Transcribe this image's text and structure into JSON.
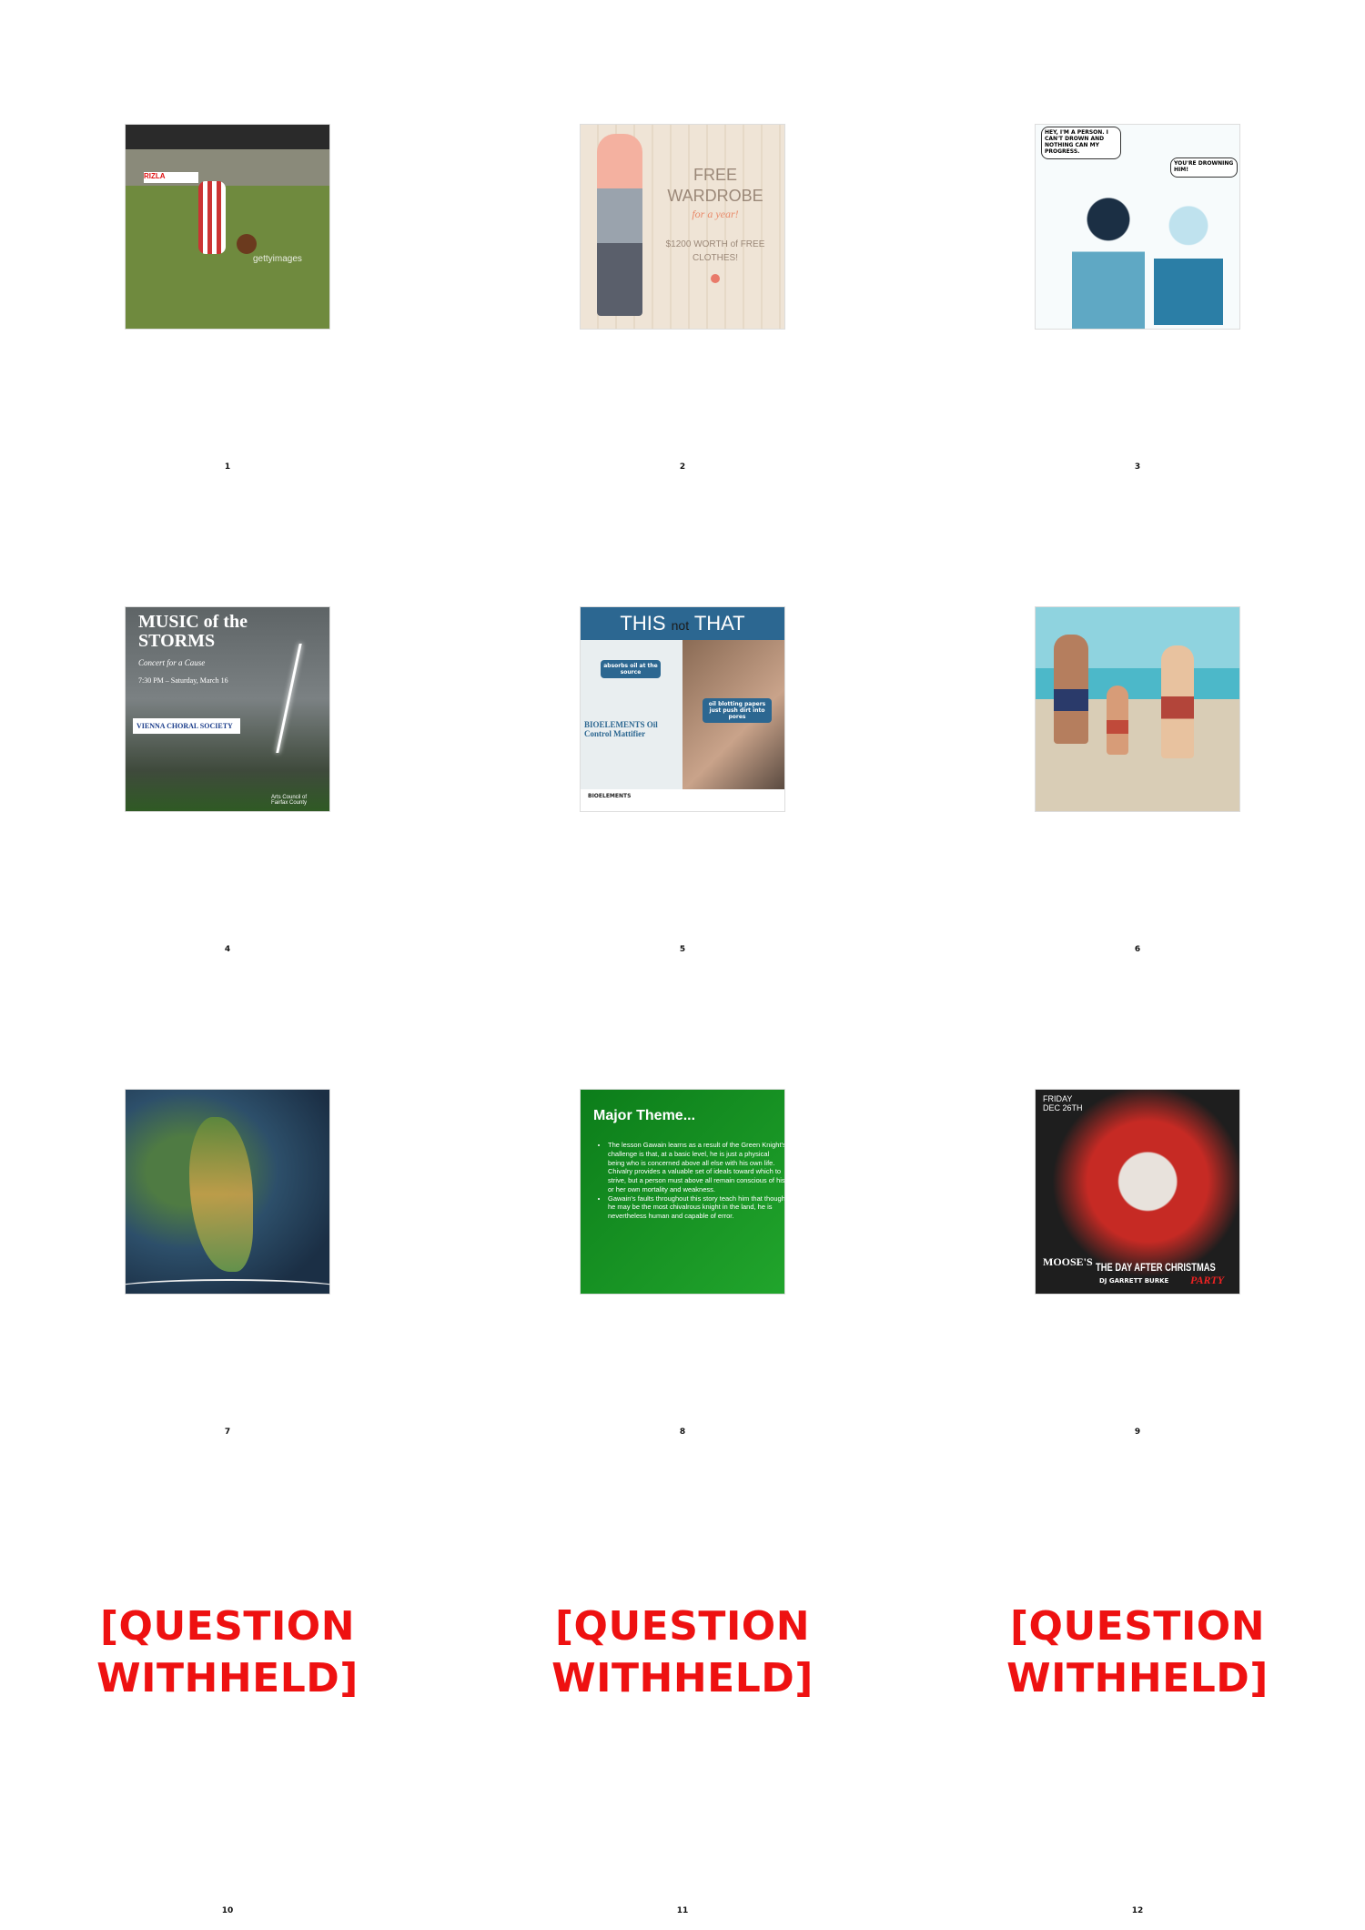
{
  "tiles": [
    {
      "number": "1",
      "watermark": "gettyimages"
    },
    {
      "number": "2",
      "headline": "FREE WARDROBE",
      "sub": "for a year!",
      "offer": "$1200 WORTH of FREE CLOTHES!"
    },
    {
      "number": "3",
      "bubble_left": "HEY, I'M A PERSON. I CAN'T DROWN AND NOTHING CAN MY PROGRESS.",
      "bubble_right": "YOU'RE DROWNING HIM!"
    },
    {
      "number": "4",
      "title": "MUSIC of the STORMS",
      "subtitle": "Concert for a Cause",
      "date": "7:30 PM – Saturday, March 16",
      "org": "VIENNA CHORAL SOCIETY",
      "footer": "Arts Council of Fairfax County"
    },
    {
      "number": "5",
      "header_this": "THIS",
      "header_not": "not",
      "header_that": "THAT",
      "badge_left": "absorbs oil at the source",
      "badge_right": "oil blotting papers just push dirt into pores",
      "product": "BIOELEMENTS Oil Control Mattifier",
      "footer": "BIOELEMENTS"
    },
    {
      "number": "6"
    },
    {
      "number": "7"
    },
    {
      "number": "8",
      "title": "Major Theme...",
      "bullets": [
        "The lesson Gawain learns as a result of the Green Knight's challenge is that, at a basic level, he is just a physical being who is concerned above all else with his own life. Chivalry provides a valuable set of ideals toward which to strive, but a person must above all remain conscious of his or her own mortality and weakness.",
        "Gawain's faults throughout this story teach him that though he may be the most chivalrous knight in the land, he is nevertheless human and capable of error."
      ]
    },
    {
      "number": "9",
      "date": "FRIDAY DEC 26TH",
      "venue": "MOOSE'S",
      "title": "THE DAY AFTER CHRISTMAS",
      "party": "PARTY",
      "dj": "DJ GARRETT BURKE"
    },
    {
      "number": "10",
      "caption": "[Question withheld]"
    },
    {
      "number": "11",
      "caption": "[Question withheld]"
    },
    {
      "number": "12",
      "caption": "[Question withheld]"
    }
  ]
}
